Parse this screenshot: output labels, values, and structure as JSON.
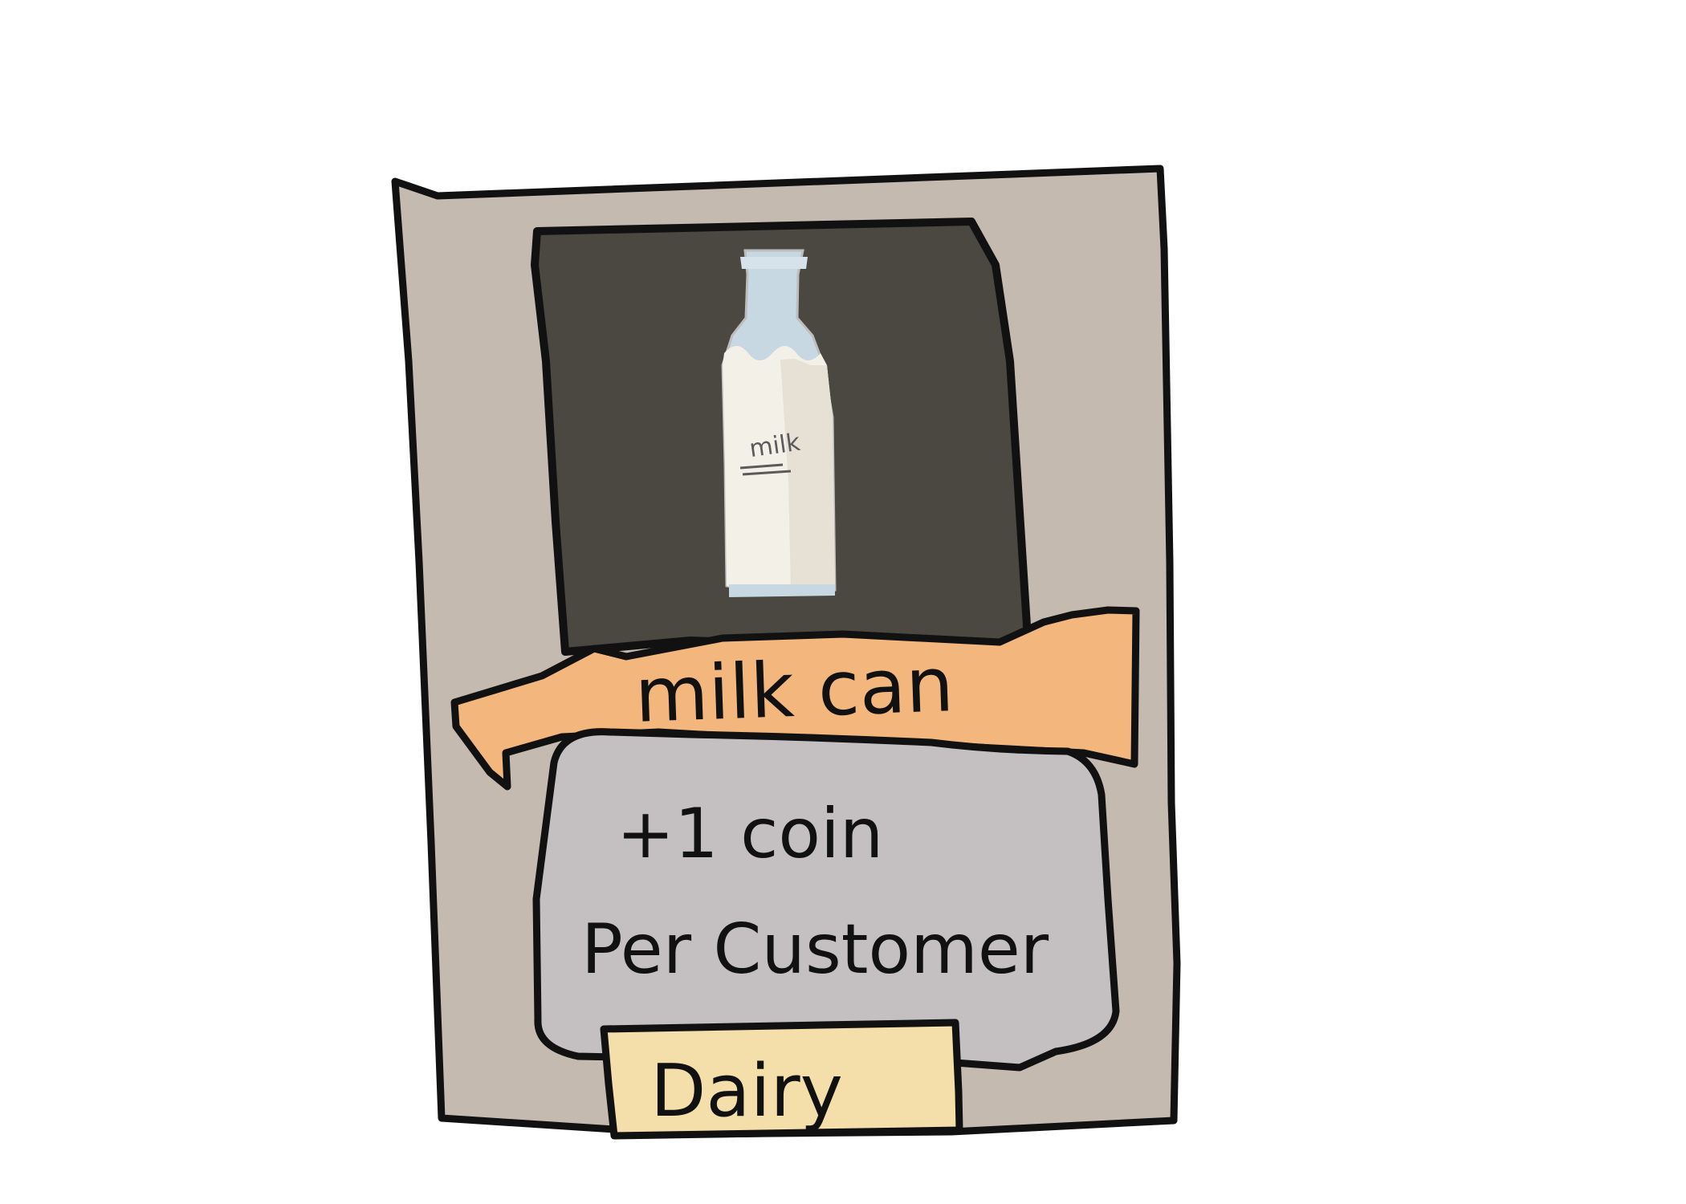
{
  "card": {
    "name": "milk can",
    "effect_line1": "+1 coin",
    "effect_line2": "Per Customer",
    "category": "Dairy"
  },
  "artwork": {
    "subject": "milk-bottle",
    "bottle_label": "milk"
  },
  "colors": {
    "card_frame": "#c4bab0",
    "art_panel": "#4a4840",
    "bottle_cap": "#c7d8e2",
    "bottle_body": "#f3f0e8",
    "ribbon": "#f3b77e",
    "effect_box": "#c4c0c1",
    "category_tag": "#f4deaa",
    "outline": "#111111"
  }
}
